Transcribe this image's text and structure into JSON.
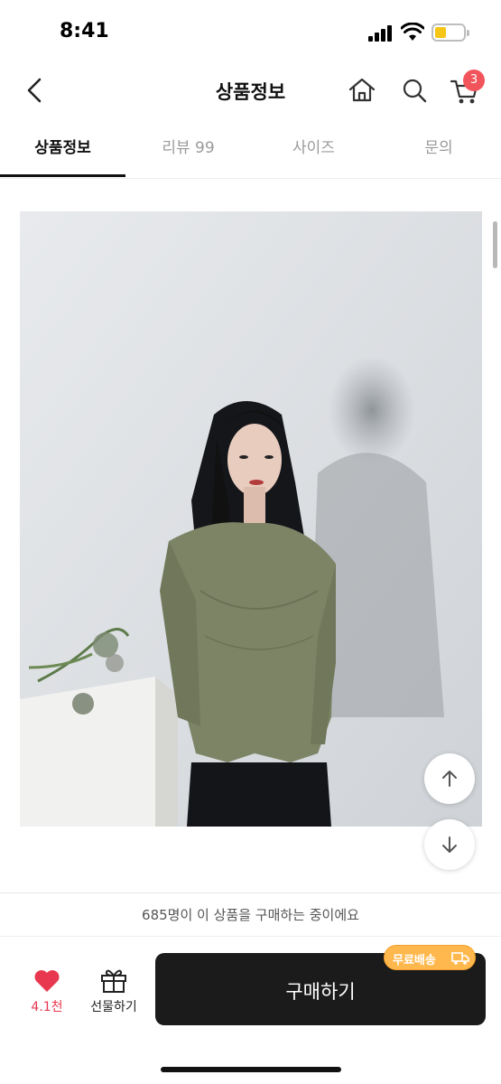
{
  "status_bar": {
    "time": "8:41"
  },
  "header": {
    "title": "상품정보",
    "cart_count": "3"
  },
  "tabs": [
    {
      "label": "상품정보",
      "active": true
    },
    {
      "label": "리뷰 99",
      "active": false
    },
    {
      "label": "사이즈",
      "active": false
    },
    {
      "label": "문의",
      "active": false
    }
  ],
  "product": {
    "top_color": "#7d8466",
    "background_color": "#d9dcdf"
  },
  "bottom": {
    "notice": "685명이 이 상품을 구매하는 중이에요",
    "like_count": "4.1천",
    "gift_label": "선물하기",
    "buy_label": "구매하기",
    "shipping_badge": "무료배송"
  },
  "colors": {
    "accent_red": "#e8384f",
    "buy_button": "#1b1b1b",
    "shipping_badge": "#ffb84d"
  }
}
